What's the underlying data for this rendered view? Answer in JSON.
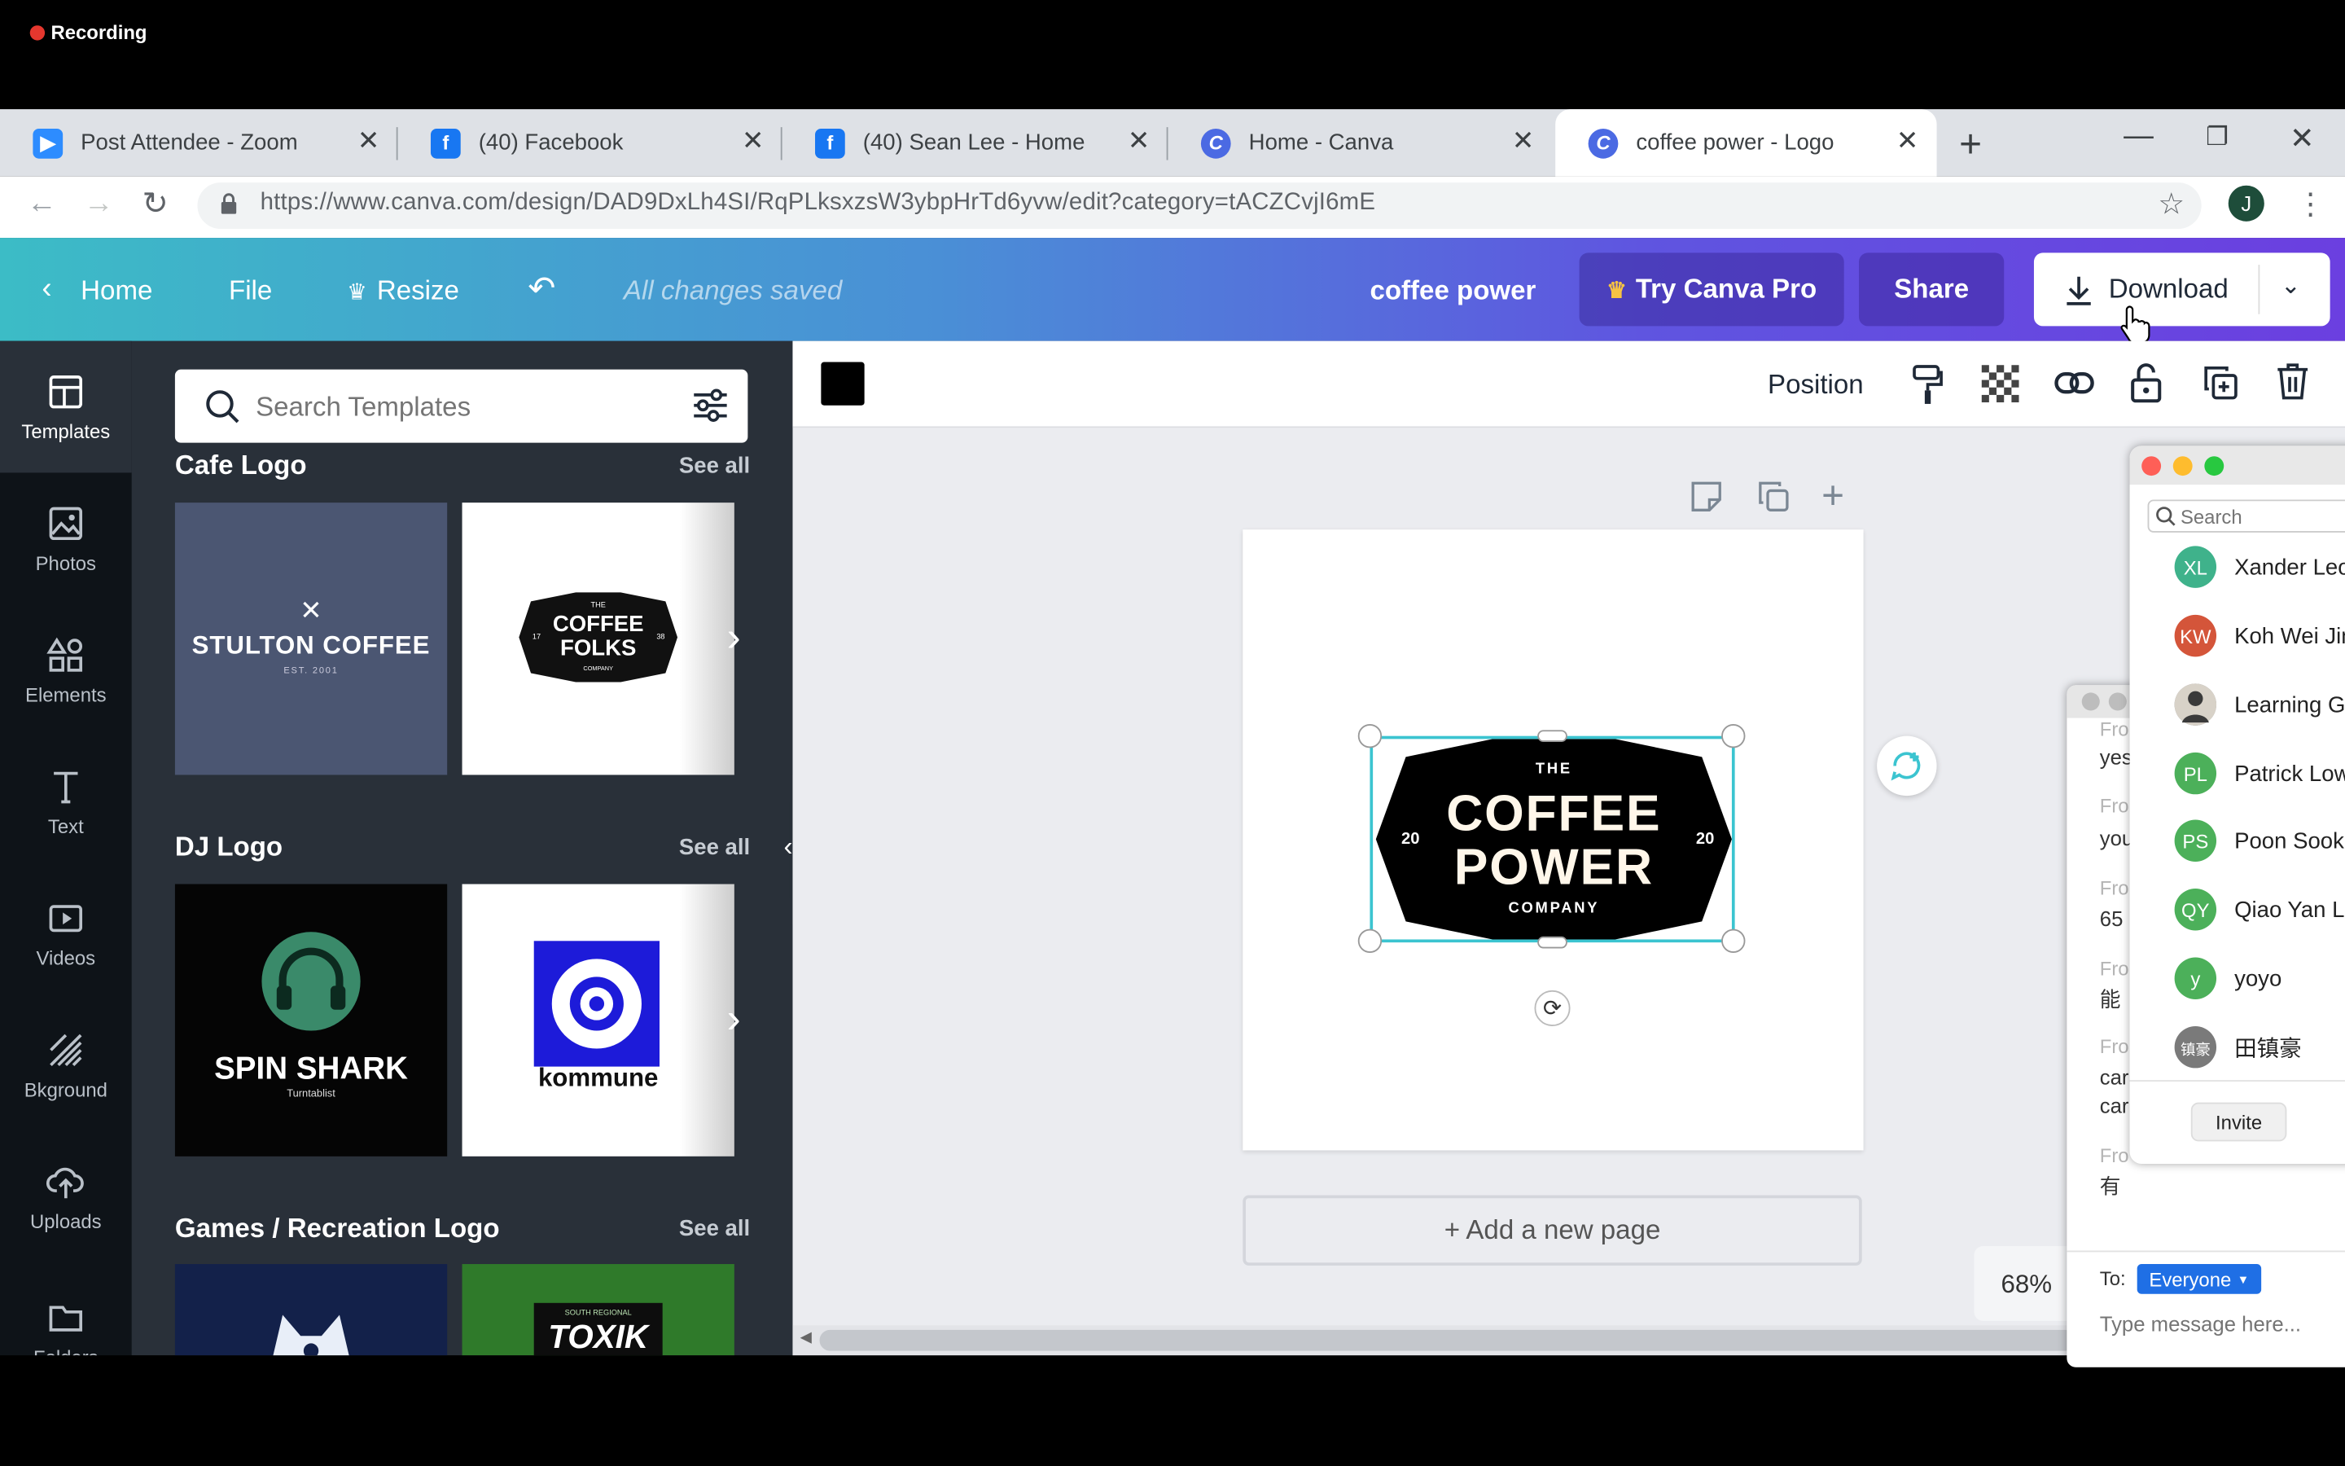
{
  "recording": {
    "label": "Recording"
  },
  "tabs": [
    {
      "title": "Post Attendee - Zoom",
      "icon": "zoom-icon",
      "color": "#2d8cff"
    },
    {
      "title": "(40) Facebook",
      "icon": "facebook-icon",
      "color": "#1877f2"
    },
    {
      "title": "(40) Sean Lee - Home",
      "icon": "facebook-icon",
      "color": "#1877f2"
    },
    {
      "title": "Home - Canva",
      "icon": "canva-icon",
      "color": "#4b6ae3"
    },
    {
      "title": "coffee power - Logo",
      "icon": "canva-icon",
      "color": "#4b6ae3"
    }
  ],
  "address_bar": {
    "url": "https://www.canva.com/design/DAD9DxLh4SI/RqPLksxzsW3ybpHrTd6yvw/edit?category=tACZCvjI6mE",
    "profile_initial": "J"
  },
  "header": {
    "home": "Home",
    "file": "File",
    "resize": "Resize",
    "status": "All changes saved",
    "design_title": "coffee power",
    "try_pro": "Try Canva Pro",
    "share": "Share",
    "download": "Download"
  },
  "rail": [
    {
      "label": "Templates",
      "icon": "templates-icon"
    },
    {
      "label": "Photos",
      "icon": "photos-icon"
    },
    {
      "label": "Elements",
      "icon": "elements-icon"
    },
    {
      "label": "Text",
      "icon": "text-icon"
    },
    {
      "label": "Videos",
      "icon": "videos-icon"
    },
    {
      "label": "Bkground",
      "icon": "background-icon"
    },
    {
      "label": "Uploads",
      "icon": "uploads-icon"
    },
    {
      "label": "Folders",
      "icon": "folders-icon"
    }
  ],
  "panel": {
    "search_placeholder": "Search Templates",
    "see_all": "See all",
    "sections": [
      {
        "title": "Cafe Logo"
      },
      {
        "title": "DJ Logo"
      },
      {
        "title": "Games / Recreation Logo"
      }
    ],
    "thumbs": {
      "stulton_name": "STULTON COFFEE",
      "stulton_est": "EST. 2001",
      "folks_the": "THE",
      "folks_line1": "COFFEE",
      "folks_line2": "FOLKS",
      "folks_company": "COMPANY",
      "folks_left": "17",
      "folks_right": "38",
      "spin_name": "SPIN SHARK",
      "spin_sub": "Turntablist",
      "kommune": "kommune",
      "toxik_top": "SOUTH REGIONAL",
      "toxik": "TOXIK"
    }
  },
  "toolbar": {
    "color_swatch": "#000000",
    "position": "Position"
  },
  "logo": {
    "the": "THE",
    "line1": "COFFEE",
    "line2": "POWER",
    "company": "COMPANY",
    "left_num": "20",
    "right_num": "20"
  },
  "canvas": {
    "add_page": "+ Add a new page",
    "zoom": "68%"
  },
  "zoom_participants": {
    "search_placeholder": "Search",
    "invite": "Invite",
    "people": [
      {
        "initials": "XL",
        "name": "Xander Leow",
        "color": "#3fb28b"
      },
      {
        "initials": "KW",
        "name": "Koh Wei Jin",
        "color": "#d4553a"
      },
      {
        "initials": "",
        "name": "Learning Gr",
        "color": "#8a8a8a"
      },
      {
        "initials": "PL",
        "name": "Patrick Low",
        "color": "#4cb05a"
      },
      {
        "initials": "PS",
        "name": "Poon Sook",
        "color": "#4cb05a"
      },
      {
        "initials": "QY",
        "name": "Qiao Yan Le",
        "color": "#4cb05a"
      },
      {
        "initials": "y",
        "name": "yoyo",
        "color": "#4cb05a"
      },
      {
        "initials": "镇豪",
        "name": "田镇豪",
        "color": "#7a7a7a"
      }
    ]
  },
  "zoom_chat": {
    "from": "Fro",
    "messages": [
      "yes",
      "you",
      "65",
      "能",
      "car",
      "car",
      "有"
    ],
    "to_label": "To:",
    "to_value": "Everyone",
    "input_placeholder": "Type message here..."
  }
}
